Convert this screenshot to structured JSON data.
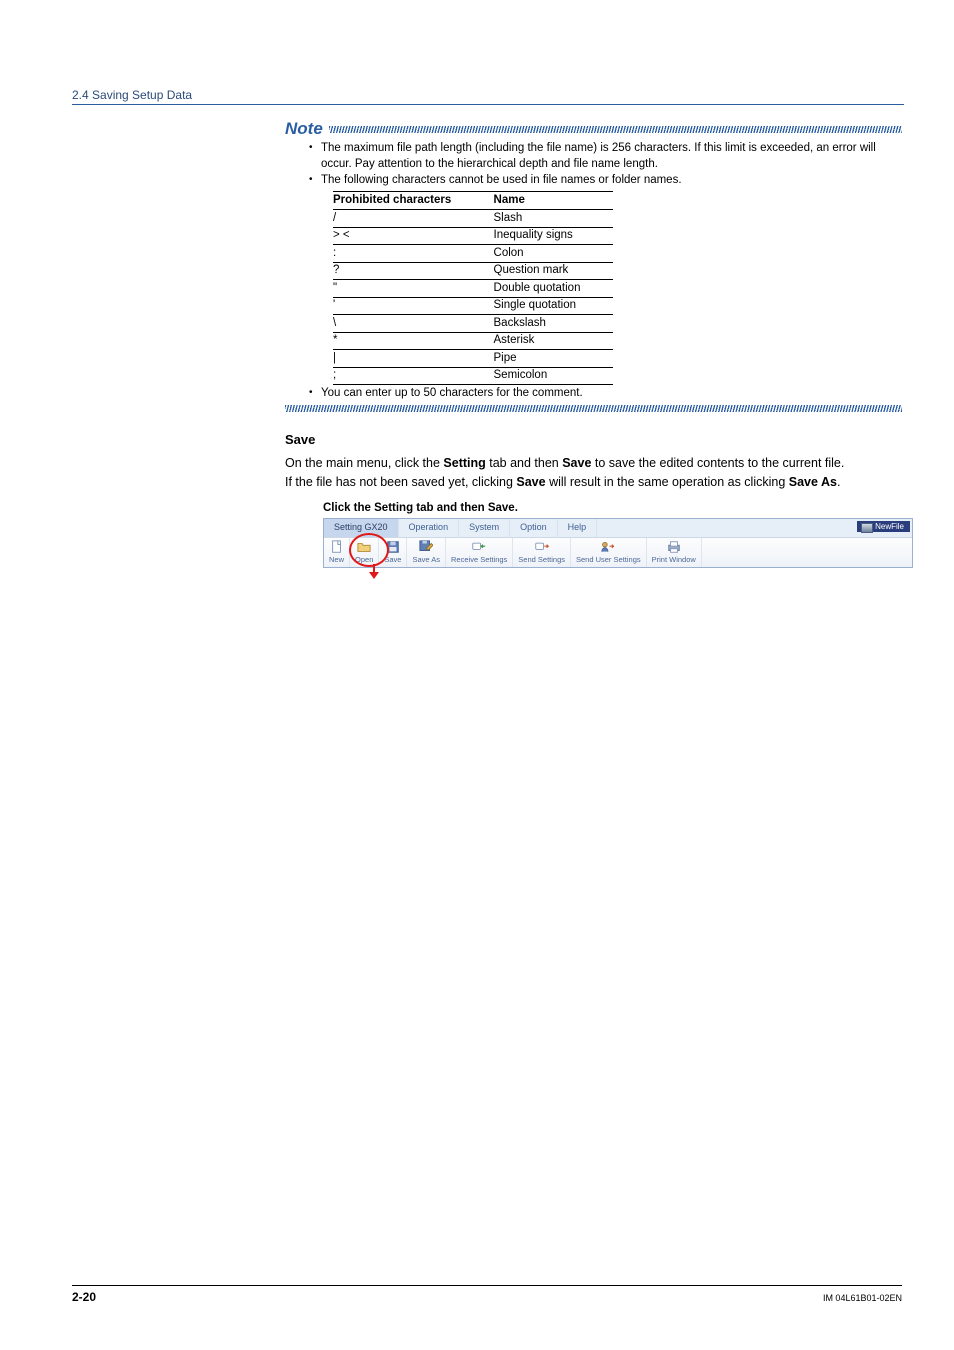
{
  "section": "2.4  Saving Setup Data",
  "note_label": "Note",
  "note_bullets": [
    "The maximum file path length (including the file name) is 256 characters. If this limit is exceeded, an error will occur. Pay attention to the hierarchical depth and file name length.",
    "The following characters cannot be used in file names or folder names."
  ],
  "prohibited_table": {
    "headers": [
      "Prohibited characters",
      "Name"
    ],
    "rows": [
      [
        "/",
        "Slash"
      ],
      [
        "> <",
        "Inequality signs"
      ],
      [
        ":",
        "Colon"
      ],
      [
        "?",
        "Question mark"
      ],
      [
        "\"",
        "Double quotation"
      ],
      [
        "'",
        "Single quotation"
      ],
      [
        "\\",
        "Backslash"
      ],
      [
        "*",
        "Asterisk"
      ],
      [
        "|",
        "Pipe"
      ],
      [
        ";",
        "Semicolon"
      ]
    ]
  },
  "note_trailing": "You can enter up to 50 characters for the comment.",
  "save": {
    "heading": "Save",
    "para1_pre": "On the main menu, click the ",
    "para1_b1": "Setting",
    "para1_mid": " tab and then ",
    "para1_b2": "Save",
    "para1_post": " to save the edited contents to the current file.",
    "para2_pre": "If the file has not been saved yet, clicking ",
    "para2_b1": "Save",
    "para2_mid": " will result in the same operation as clicking ",
    "para2_b2": "Save As",
    "para2_post": ".",
    "caption": "Click the Setting tab and then Save."
  },
  "tabs": {
    "active": "Setting GX20",
    "others": [
      "Operation",
      "System",
      "Option",
      "Help"
    ],
    "newfile": "NewFile"
  },
  "toolbar": {
    "new": "New",
    "open": "Open",
    "save": "Save",
    "saveas": "Save As",
    "recv": "Receive Settings",
    "send": "Send Settings",
    "senduser": "Send User Settings",
    "print": "Print Window"
  },
  "footer": {
    "page": "2-20",
    "docid": "IM 04L61B01-02EN"
  }
}
